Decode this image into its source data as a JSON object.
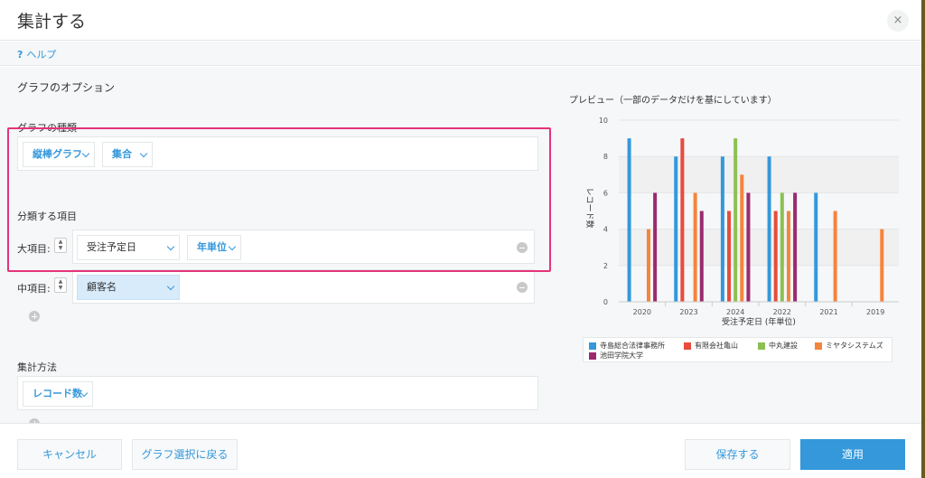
{
  "dialog": {
    "title": "集計する",
    "close_glyph": "×",
    "help_glyph": "?",
    "help_label": "ヘルプ"
  },
  "options": {
    "title": "グラフのオプション",
    "graph_type": {
      "label": "グラフの種類",
      "type_value": "縦棒グラフ",
      "mode_value": "集合"
    },
    "classification": {
      "label": "分類する項目",
      "major_label": "大項目:",
      "major_field": "受注予定日",
      "major_unit": "年単位",
      "middle_label": "中項目:",
      "middle_field": "顧客名"
    },
    "aggregation": {
      "label": "集計方法",
      "value": "レコード数"
    }
  },
  "preview": {
    "title": "プレビュー（一部のデータだけを基にしています）"
  },
  "chart_data": {
    "type": "bar",
    "categories": [
      "2020",
      "2023",
      "2024",
      "2022",
      "2021",
      "2019"
    ],
    "xlabel": "受注予定日 (年単位)",
    "ylabel": "レコード数",
    "ylim": [
      0,
      10
    ],
    "yticks": [
      0,
      2,
      4,
      6,
      8,
      10
    ],
    "grid": true,
    "legend": "bottom",
    "series": [
      {
        "name": "寺島総合法律事務所",
        "color": "#3498db",
        "values": [
          9,
          8,
          8,
          8,
          6,
          null
        ]
      },
      {
        "name": "有限会社亀山",
        "color": "#e74c3c",
        "values": [
          null,
          9,
          5,
          5,
          null,
          null
        ]
      },
      {
        "name": "中丸建設",
        "color": "#8cc152",
        "values": [
          null,
          null,
          9,
          6,
          null,
          null
        ]
      },
      {
        "name": "ミヤタシステムズ",
        "color": "#f5843c",
        "values": [
          4,
          6,
          7,
          5,
          5,
          4
        ]
      },
      {
        "name": "池田学院大学",
        "color": "#9b2a6e",
        "values": [
          6,
          5,
          6,
          6,
          null,
          null
        ]
      }
    ]
  },
  "footer": {
    "cancel": "キャンセル",
    "back": "グラフ選択に戻る",
    "save": "保存する",
    "apply": "適用"
  }
}
